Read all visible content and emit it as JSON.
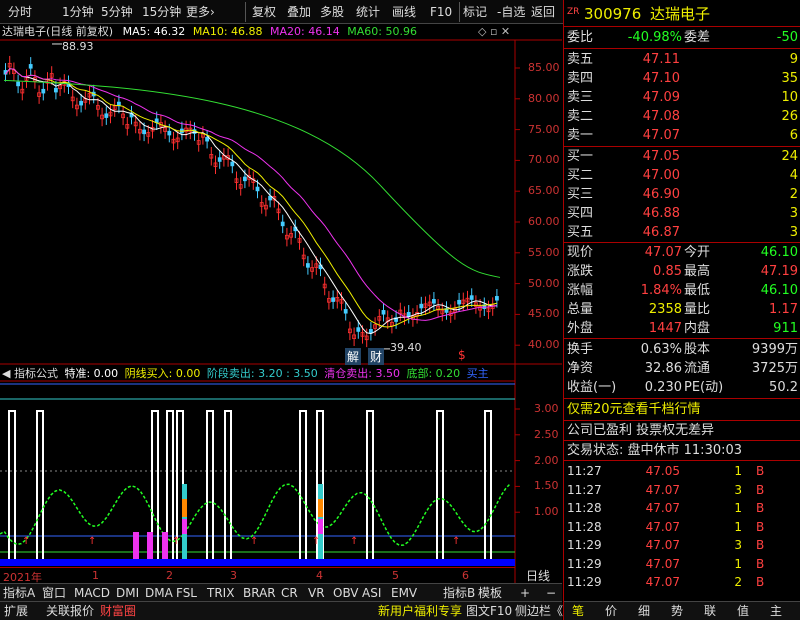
{
  "toolbar": {
    "items": [
      "分时",
      "1分钟",
      "5分钟",
      "15分钟",
      "更多›",
      "复权",
      "叠加",
      "多股",
      "统计",
      "画线",
      "F10",
      "标记",
      "-自选",
      "返回"
    ]
  },
  "chart_title": {
    "name": "达瑞电子(日线 前复权)",
    "ma5": "MA5: 46.32",
    "ma10": "MA10: 46.88",
    "ma20": "MA20: 46.14",
    "ma60": "MA60: 50.96"
  },
  "price_axis": [
    "85.00",
    "80.00",
    "75.00",
    "70.00",
    "65.00",
    "60.00",
    "55.00",
    "50.00",
    "45.00",
    "40.00"
  ],
  "annotations": {
    "high": "88.93",
    "low": "39.40",
    "jie": "解",
    "cai": "财",
    "dollar": "$"
  },
  "indicator_title": {
    "name": "指标公式",
    "a": "特准: 0.00",
    "b": "阴线买入: 0.00",
    "c": "阶段卖出: 3.20 : 3.50",
    "d": "清仓卖出: 3.50",
    "e": "底部: 0.20",
    "f": "买主"
  },
  "indicator_axis": [
    "3.00",
    "2.50",
    "2.00",
    "1.50",
    "1.00"
  ],
  "time_axis": {
    "year": "2021年",
    "months": [
      "1",
      "2",
      "3",
      "4",
      "5",
      "6"
    ],
    "period": "日线"
  },
  "bottom_tabs": [
    "指标A",
    "窗口",
    "MACD",
    "DMI",
    "DMA",
    "FSL",
    "TRIX",
    "BRAR",
    "CR",
    "VR",
    "OBV",
    "ASI",
    "EMV",
    "指标B",
    "模板",
    "+",
    "−"
  ],
  "status_bar": {
    "left": [
      "扩展",
      "关联报价",
      "财富圈"
    ],
    "right": [
      "新用户福利专享",
      "图文F10",
      "侧边栏《"
    ]
  },
  "stock": {
    "tag": "ZR",
    "code": "300976",
    "name": "达瑞电子"
  },
  "weibi": {
    "label": "委比",
    "value": "-40.98%",
    "label2": "委差",
    "value2": "-50"
  },
  "asks": [
    {
      "label": "卖五",
      "price": "47.11",
      "vol": "9"
    },
    {
      "label": "卖四",
      "price": "47.10",
      "vol": "35"
    },
    {
      "label": "卖三",
      "price": "47.09",
      "vol": "10"
    },
    {
      "label": "卖二",
      "price": "47.08",
      "vol": "26"
    },
    {
      "label": "卖一",
      "price": "47.07",
      "vol": "6"
    }
  ],
  "bids": [
    {
      "label": "买一",
      "price": "47.05",
      "vol": "24"
    },
    {
      "label": "买二",
      "price": "47.00",
      "vol": "4"
    },
    {
      "label": "买三",
      "price": "46.90",
      "vol": "2"
    },
    {
      "label": "买四",
      "price": "46.88",
      "vol": "3"
    },
    {
      "label": "买五",
      "price": "46.87",
      "vol": "3"
    }
  ],
  "quote": [
    {
      "l1": "现价",
      "v1": "47.07",
      "l2": "今开",
      "v2": "46.10",
      "c1": "red",
      "c2": "green"
    },
    {
      "l1": "涨跌",
      "v1": "0.85",
      "l2": "最高",
      "v2": "47.19",
      "c1": "red",
      "c2": "red"
    },
    {
      "l1": "涨幅",
      "v1": "1.84%",
      "l2": "最低",
      "v2": "46.10",
      "c1": "red",
      "c2": "green"
    },
    {
      "l1": "总量",
      "v1": "2358",
      "l2": "量比",
      "v2": "1.17",
      "c1": "yellow",
      "c2": "red"
    },
    {
      "l1": "外盘",
      "v1": "1447",
      "l2": "内盘",
      "v2": "911",
      "c1": "red",
      "c2": "green"
    }
  ],
  "fin": [
    {
      "l1": "换手",
      "v1": "0.63%",
      "l2": "股本",
      "v2": "9399万"
    },
    {
      "l1": "净资",
      "v1": "32.86",
      "l2": "流通",
      "v2": "3725万"
    },
    {
      "l1": "收益(一)",
      "v1": "0.230",
      "l2": "PE(动)",
      "v2": "50.2"
    }
  ],
  "promo": "仅需20元查看千档行情",
  "info": "公司已盈利 投票权无差异",
  "trade_status": "交易状态: 盘中休市 11:30:03",
  "ticks": [
    {
      "t": "11:27",
      "p": "47.05",
      "v": "1",
      "s": "B"
    },
    {
      "t": "11:27",
      "p": "47.07",
      "v": "3",
      "s": "B"
    },
    {
      "t": "11:28",
      "p": "47.07",
      "v": "1",
      "s": "B"
    },
    {
      "t": "11:28",
      "p": "47.07",
      "v": "1",
      "s": "B"
    },
    {
      "t": "11:29",
      "p": "47.07",
      "v": "3",
      "s": "B"
    },
    {
      "t": "11:29",
      "p": "47.07",
      "v": "1",
      "s": "B"
    },
    {
      "t": "11:29",
      "p": "47.07",
      "v": "2",
      "s": "B"
    }
  ],
  "right_tabs": [
    "笔",
    "价",
    "细",
    "势",
    "联",
    "值",
    "主"
  ]
}
